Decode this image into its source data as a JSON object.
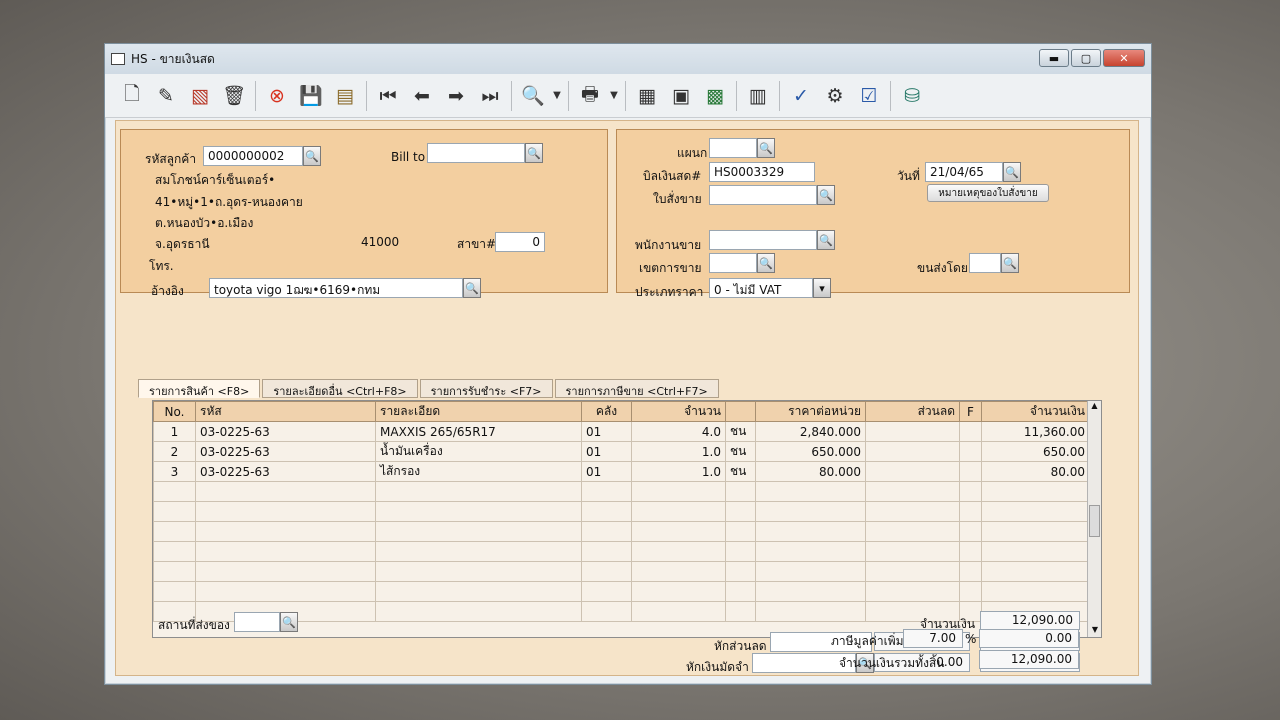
{
  "window": {
    "title": "HS - ขายเงินสด",
    "min_label": "▬",
    "max_label": "▢",
    "close_label": "✕"
  },
  "toolbar": {
    "icons": [
      "new-doc-icon",
      "edit-icon",
      "void-icon",
      "trash-icon",
      "cancel-icon",
      "save-icon",
      "money-icon",
      "first-record-icon",
      "prev-record-icon",
      "next-record-icon",
      "last-record-icon",
      "search-doc-icon",
      "dropdown-icon",
      "print-icon",
      "dropdown-icon",
      "calculator-icon",
      "register-icon",
      "monitor-icon",
      "receipt-icon",
      "ok-user-icon",
      "tools-icon",
      "ok-file-icon",
      "network-icon"
    ]
  },
  "customer": {
    "code_label": "รหัสลูกค้า",
    "code": "0000000002",
    "billto_label": "Bill to",
    "billto": "",
    "name": "สมโภชน์คาร์เซ็นเตอร์•",
    "addr1": "41•หมู่•1•ถ.อุดร-หนองคาย",
    "addr2": "ต.หนองบัว•อ.เมือง",
    "province": "จ.อุดรธานี",
    "postcode": "41000",
    "branch_label": "สาขา#",
    "branch": "0",
    "phone_label": "โทร.",
    "ref_label": "อ้างอิง",
    "ref": "toyota vigo 1ฌฆ•6169•กทม"
  },
  "doc": {
    "dept_label": "แผนก",
    "dept": "",
    "bill_label": "บิลเงินสด#",
    "bill": "HS0003329",
    "date_label": "วันที่",
    "date": "21/04/65",
    "order_label": "ใบสั่งขาย",
    "order": "",
    "note_button": "หมายเหตุของใบสั่งขาย",
    "sales_label": "พนักงานขาย",
    "sales": "",
    "area_label": "เขตการขาย",
    "area": "",
    "ship_label": "ขนส่งโดย",
    "ship": "",
    "price_type_label": "ประเภทราคา",
    "price_type": "0 - ไม่มี VAT"
  },
  "tabs": [
    "รายการสินค้า <F8>",
    "รายละเอียดอื่น <Ctrl+F8>",
    "รายการรับชำระ <F7>",
    "รายการภาษีขาย <Ctrl+F7>"
  ],
  "grid": {
    "headers": [
      "No.",
      "รหัส",
      "รายละเอียด",
      "คลัง",
      "จำนวน",
      "",
      "ราคาต่อหน่วย",
      "ส่วนลด",
      "F",
      "จำนวนเงิน"
    ],
    "rows": [
      [
        "1",
        "03-0225-63",
        "MAXXIS 265/65R17",
        "01",
        "4.0",
        "ชน",
        "2,840.000",
        "",
        "",
        "11,360.00"
      ],
      [
        "2",
        "03-0225-63",
        "น้ำมันเครื่อง",
        "01",
        "1.0",
        "ชน",
        "650.000",
        "",
        "",
        "650.00"
      ],
      [
        "3",
        "03-0225-63",
        "ไส้กรอง",
        "01",
        "1.0",
        "ชน",
        "80.000",
        "",
        "",
        "80.00"
      ]
    ]
  },
  "footer": {
    "ship_place_label": "สถานที่ส่งของ",
    "ship_place": "",
    "amount_label": "จำนวนเงิน",
    "amount": "12,090.00",
    "discount_label": "หักส่วนลด",
    "discount_text": "",
    "discount": "0.00",
    "after_discount": "12,090.00",
    "deposit_label": "หักเงินมัดจำ",
    "deposit_text": "",
    "deposit": "0.00",
    "after_deposit": "12,090.00",
    "vat_label": "ภาษีมูลค่าเพิ่ม",
    "vat_rate": "7.00",
    "vat_pct": "%",
    "vat_amount": "0.00",
    "total_label": "จำนวนเงินรวมทั้งสิ้น",
    "total": "12,090.00"
  }
}
